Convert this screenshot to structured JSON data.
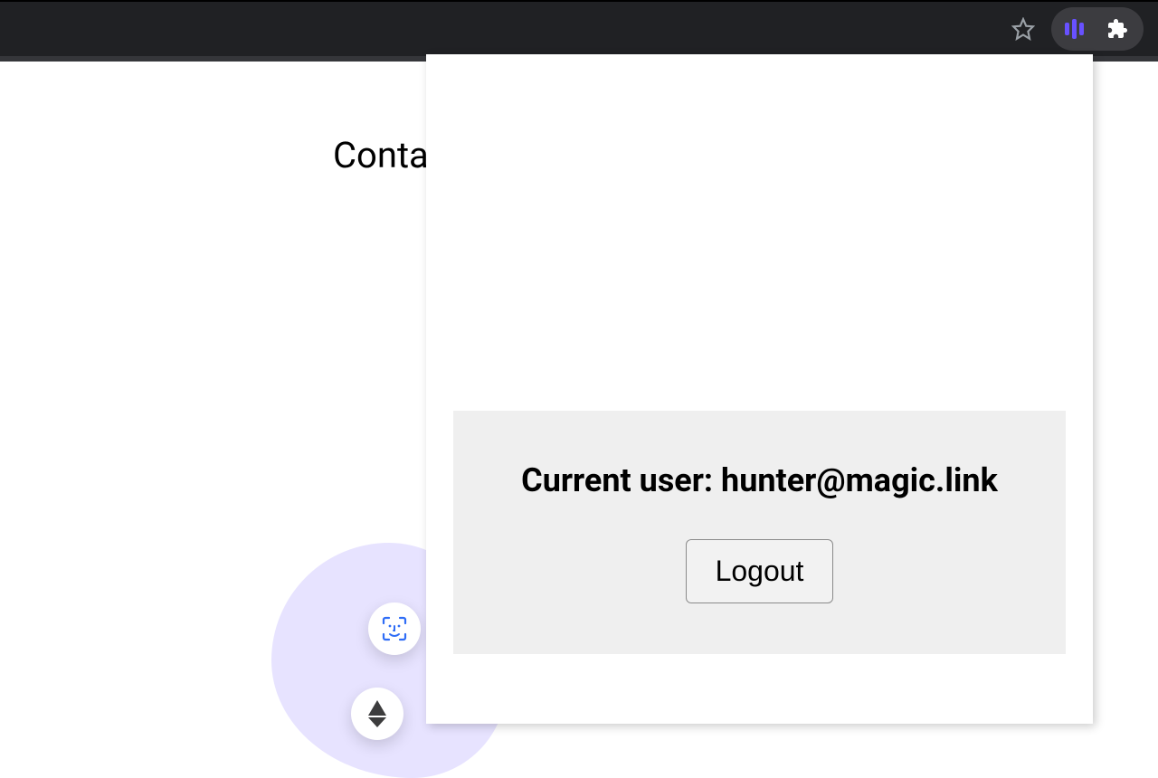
{
  "browser": {
    "starLabel": "bookmark-star",
    "magicExtLabel": "magic-extension",
    "puzzleLabel": "extensions"
  },
  "page": {
    "heading": "Conta"
  },
  "popup": {
    "currentUserLabel": "Current user: ",
    "currentUserEmail": "hunter@magic.link",
    "logoutLabel": "Logout"
  }
}
